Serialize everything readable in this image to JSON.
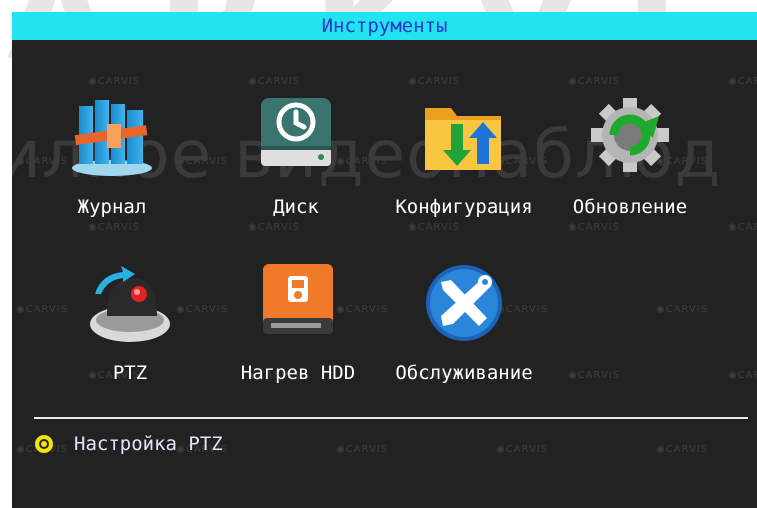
{
  "window": {
    "title": "Инструменты"
  },
  "watermark": {
    "top_text": "ARKVI",
    "center_text": "илное видеонаблюд",
    "logo_text": "CARVIS"
  },
  "menu": {
    "items": [
      {
        "label": "Журнал",
        "icon": "journal-books-icon"
      },
      {
        "label": "Диск",
        "icon": "disk-drive-icon"
      },
      {
        "label": "Конфигурация",
        "icon": "config-folder-icon"
      },
      {
        "label": "Обновление",
        "icon": "update-gear-icon"
      },
      {
        "label": "PTZ",
        "icon": "ptz-camera-icon",
        "selected": true
      },
      {
        "label": "Нагрев HDD",
        "icon": "hdd-heater-icon"
      },
      {
        "label": "Обслуживание",
        "icon": "maintenance-tools-icon"
      }
    ]
  },
  "status": {
    "text": "Настройка PTZ",
    "bullet": "radio-bullet-icon"
  },
  "colors": {
    "title_bar": "#22e4f0",
    "title_text": "#2233d6",
    "background": "#222222",
    "selected_label": "#2fe0f0",
    "bullet": "#f5e400"
  }
}
